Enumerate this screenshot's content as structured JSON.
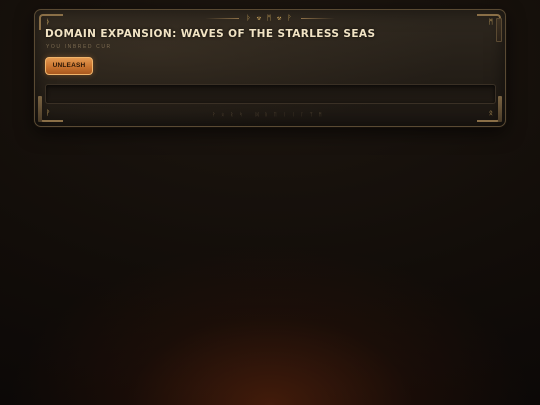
{
  "panel": {
    "header_runes": "ᚦ ⚒ ᛗ ⚒ ᚹ",
    "title": "DOMAIN EXPANSION: WAVES OF THE STARLESS SEAS",
    "subtitle": "YOU INBRED CUR",
    "unleash_label": "UNLEASH",
    "footer_runes": "ᚹᛟᚱᛋ ᛞᚱᛖᛁᛁᛚᛉᛗ",
    "corner_runes": [
      "ᚦ",
      "ᛗ",
      "ᚹ",
      "ᛟ"
    ]
  },
  "colors": {
    "accent": "#d9a25a",
    "button": "#c9742f",
    "title": "#f1e3c4",
    "panel_border": "#5a4a33"
  }
}
